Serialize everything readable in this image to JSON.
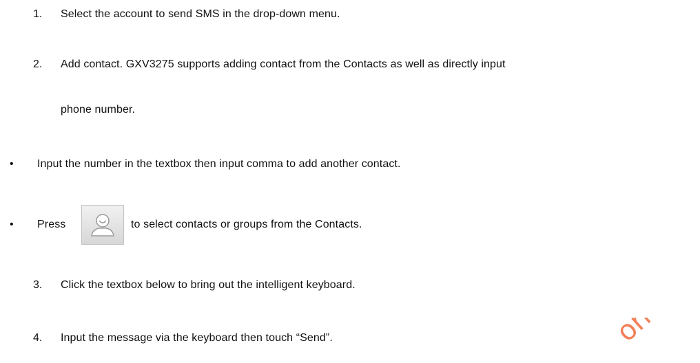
{
  "steps": [
    {
      "number": "1.",
      "text": "Select the account to send SMS in the drop-down menu."
    },
    {
      "number": "2.",
      "text_line1": "Add contact. GXV3275 supports adding contact from the Contacts as well as directly input",
      "text_line2": "phone number."
    },
    {
      "number": "3.",
      "text": "Click the textbox below to bring out the intelligent keyboard."
    },
    {
      "number": "4.",
      "text": "Input the message via the keyboard then touch “Send”."
    }
  ],
  "bullets": [
    {
      "symbol": "•",
      "text": "Input the number in the textbox then input comma to add another contact."
    },
    {
      "symbol": "•",
      "text_before": "Press",
      "icon": "contact-avatar-icon",
      "text_after": "to select contacts or groups from the Contacts."
    }
  ],
  "watermark": {
    "text": "on",
    "color": "#ef6a3c"
  }
}
